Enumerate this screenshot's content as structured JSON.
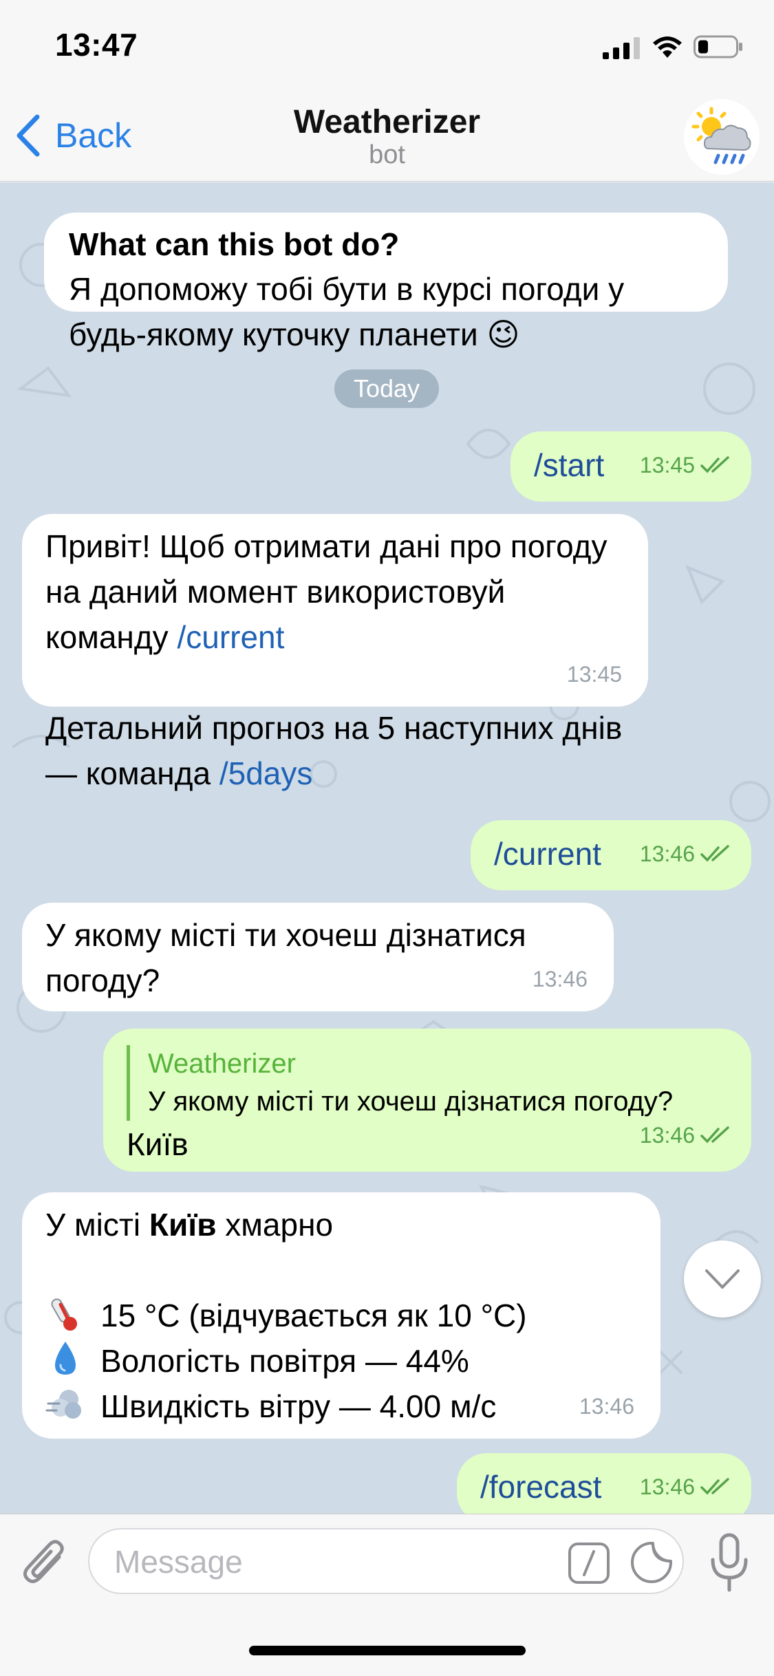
{
  "status_bar": {
    "time": "13:47"
  },
  "nav": {
    "back_label": "Back",
    "title": "Weatherizer",
    "subtitle": "bot"
  },
  "intro": {
    "title": "What can this bot do?",
    "text": "Я допоможу тобі бути в курсі погоди у будь-якому куточку планети 😉"
  },
  "date_separator": "Today",
  "messages": {
    "m1": {
      "text": "/start",
      "time": "13:45"
    },
    "m2": {
      "line1": "Привіт! Щоб отримати дані про погоду на даний момент використовуй команду ",
      "cmd1": "/current",
      "line2": "Детальний прогноз на 5 наступних днів — команда ",
      "cmd2": "/5days",
      "time": "13:45"
    },
    "m3": {
      "text": "/current",
      "time": "13:46"
    },
    "m4": {
      "text": "У якому місті ти хочеш дізнатися погоду?",
      "time": "13:46"
    },
    "m5": {
      "reply_name": "Weatherizer",
      "reply_text": "У якому місті ти хочеш дізнатися погоду?",
      "text": "Київ",
      "time": "13:46"
    },
    "m6": {
      "prefix": "У місті ",
      "city": "Київ",
      "suffix": " хмарно",
      "temp": "15 °C (відчувається як 10 °C)",
      "humidity": "Вологість повітря — 44%",
      "wind": "Швидкість вітру — 4.00 м/с",
      "time": "13:46"
    },
    "m7": {
      "text": "/forecast",
      "time": "13:46"
    }
  },
  "input": {
    "placeholder": "Message"
  }
}
